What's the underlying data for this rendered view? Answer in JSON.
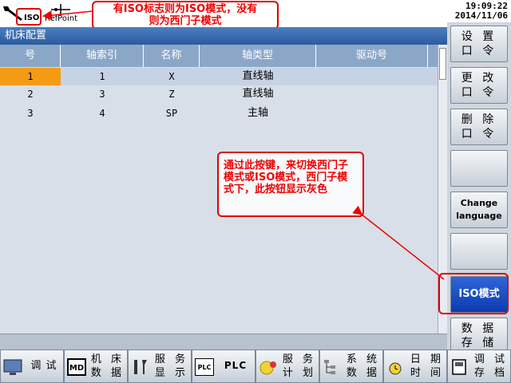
{
  "header": {
    "iso_label": "ISO",
    "refpoint_label": "RefPoint",
    "time": "19:09:22",
    "date": "2014/11/06"
  },
  "annotations": {
    "top_line1": "有ISO标志则为ISO模式，没有",
    "top_line2": "则为西门子模式",
    "mid_text": "通过此按键，来切换西门子模式或ISO模式，西门子模式下，此按钮显示灰色"
  },
  "window": {
    "title": "机床配置"
  },
  "table": {
    "columns": [
      "号",
      "轴索引",
      "名称",
      "轴类型",
      "驱动号"
    ],
    "rows": [
      [
        "1",
        "1",
        "X",
        "直线轴",
        ""
      ],
      [
        "2",
        "3",
        "Z",
        "直线轴",
        ""
      ],
      [
        "3",
        "4",
        "SP",
        "主轴",
        ""
      ]
    ]
  },
  "softkeys_right": [
    {
      "line1": "设 置",
      "line2": "口 令"
    },
    {
      "line1": "更 改",
      "line2": "口 令"
    },
    {
      "line1": "删 除",
      "line2": "口 令"
    },
    {
      "line1": "",
      "line2": ""
    },
    {
      "line1": "Change",
      "line2": "language"
    },
    {
      "line1": "",
      "line2": ""
    },
    {
      "line1": "ISO模式",
      "line2": ""
    },
    {
      "line1": "数 据",
      "line2": "存 储"
    }
  ],
  "softkeys_bottom": [
    {
      "icon": "",
      "line1": "调 试",
      "line2": ""
    },
    {
      "icon": "MD",
      "line1": "机 床",
      "line2": "数 据"
    },
    {
      "icon": "",
      "line1": "服 务",
      "line2": "显 示"
    },
    {
      "icon": "PLC",
      "line1": "PLC",
      "line2": ""
    },
    {
      "icon": "",
      "line1": "服 务",
      "line2": "计 划"
    },
    {
      "icon": "",
      "line1": "系 统",
      "line2": "数 据"
    },
    {
      "icon": "",
      "line1": "日 期",
      "line2": "时 间"
    },
    {
      "icon": "",
      "line1": "调 试",
      "line2": "存 档"
    }
  ],
  "colors": {
    "title_bar": "#2c5a9e",
    "header_row": "#8ba7c8",
    "selected_cell": "#f49b15",
    "active_softkey": "#1a4bc4",
    "annotation_red": "#e00000"
  }
}
